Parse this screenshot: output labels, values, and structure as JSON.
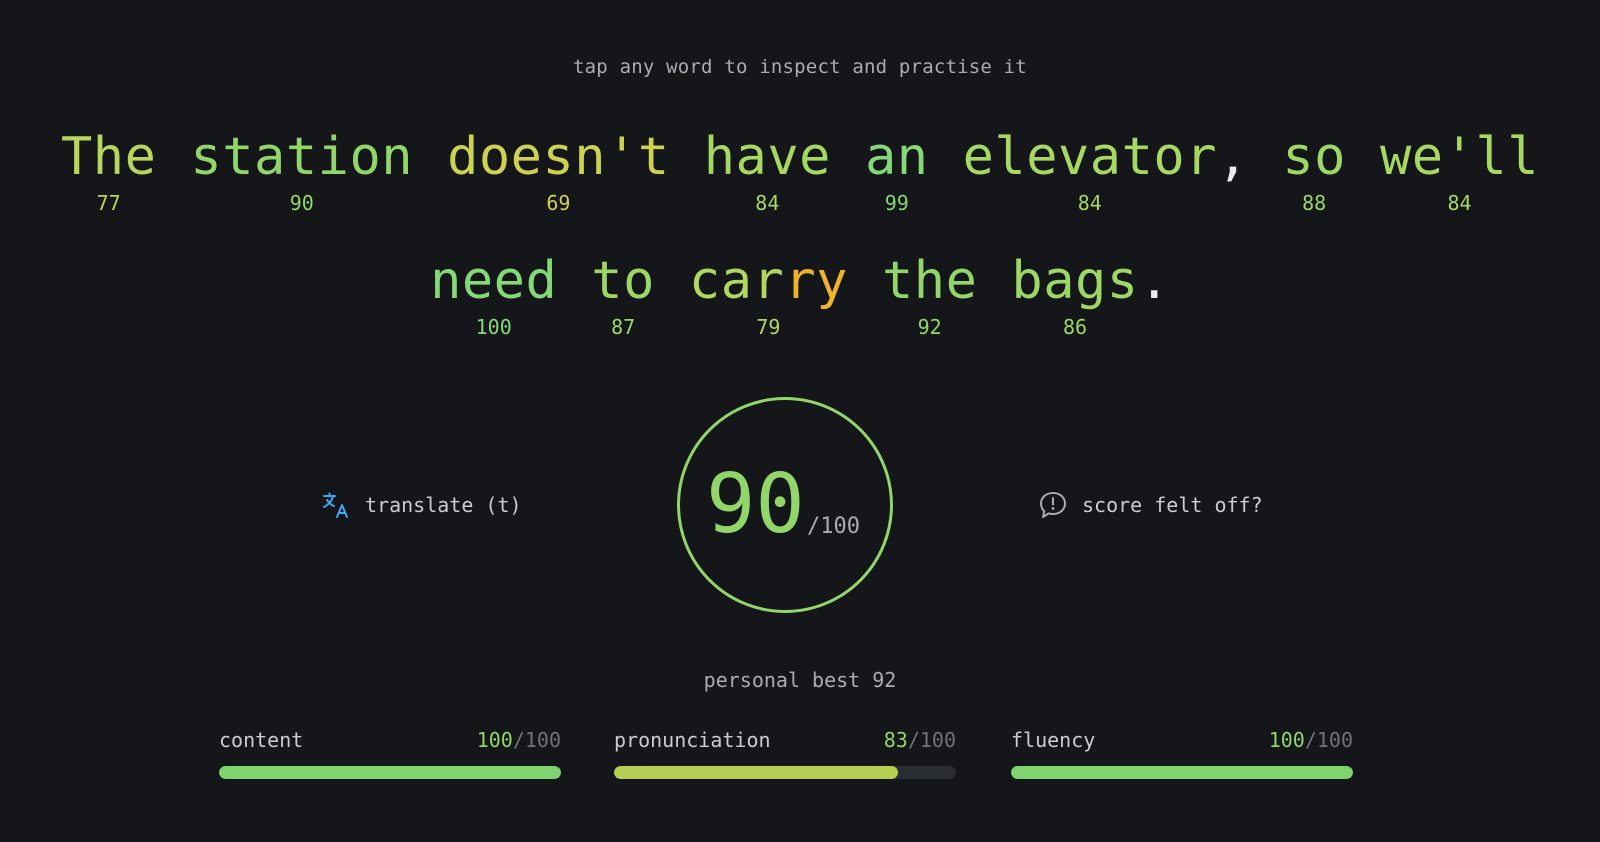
{
  "hint": "tap any word to inspect and practise it",
  "sentence": {
    "line1": [
      {
        "text": "The",
        "score": "77",
        "color": "#b8d65a"
      },
      {
        "text": "station",
        "score": "90",
        "color": "#92d66a"
      },
      {
        "text": "doesn't",
        "score": "69",
        "color": "#cfd150"
      },
      {
        "text": "have",
        "score": "84",
        "color": "#a6d862"
      },
      {
        "text": "an",
        "score": "99",
        "color": "#85d877"
      },
      {
        "text": "elevator",
        "score": "84",
        "color": "#a6d862",
        "punct": ","
      },
      {
        "text": "so",
        "score": "88",
        "color": "#9dd766"
      },
      {
        "text": "we'll",
        "score": "84",
        "color": "#a6d862"
      }
    ],
    "line2": [
      {
        "text": "need",
        "score": "100",
        "color": "#85d877"
      },
      {
        "text": "to",
        "score": "87",
        "color": "#9dd766"
      },
      {
        "text": "carry",
        "score": "79",
        "color": "#b0d85e",
        "highlight": {
          "start": "car",
          "end": "ry",
          "color": "#f0b429"
        }
      },
      {
        "text": "the",
        "score": "92",
        "color": "#92d66a"
      },
      {
        "text": "bags",
        "score": "86",
        "color": "#9dd766",
        "punct": "."
      }
    ]
  },
  "actions": {
    "translate_label": "translate (t)",
    "translate_icon": "translate-icon",
    "feedback_label": "score felt off?",
    "feedback_icon": "speech-bubble-alert-icon"
  },
  "score": {
    "value": "90",
    "max": "/100",
    "color": "#92d66a"
  },
  "personal_best": "personal best 92",
  "metrics": [
    {
      "label": "content",
      "score": "100",
      "of": "/100",
      "value": 100,
      "color": "#7fd470"
    },
    {
      "label": "pronunciation",
      "score": "83",
      "of": "/100",
      "value": 83,
      "color": "#b5cf52"
    },
    {
      "label": "fluency",
      "score": "100",
      "of": "/100",
      "value": 100,
      "color": "#7fd470"
    }
  ],
  "colors": {
    "background": "#14161a",
    "accent": "#92d66a",
    "translate_icon": "#3fa9f5"
  }
}
